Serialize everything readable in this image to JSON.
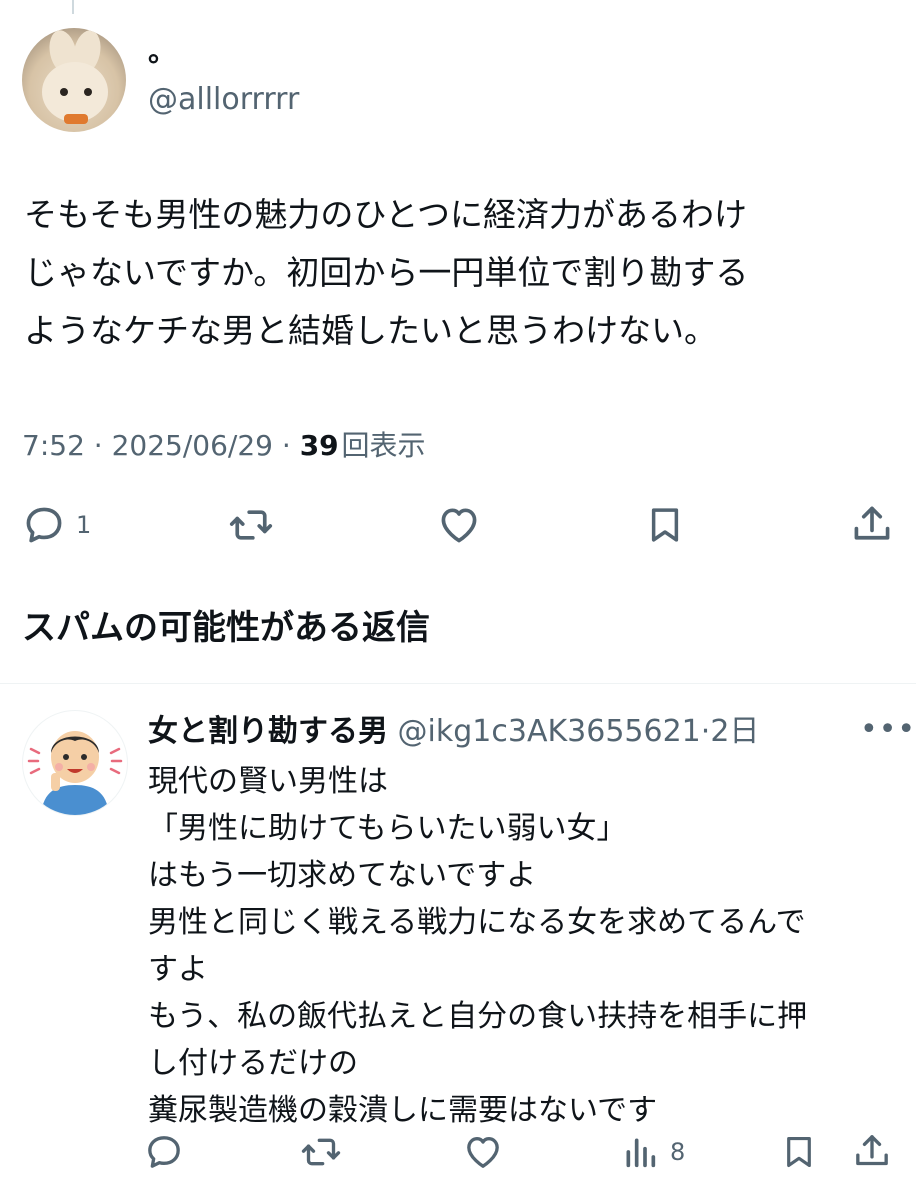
{
  "tweet": {
    "display_name": "。",
    "handle": "@alllorrrrr",
    "text_lines": [
      "そもそも男性の魅力のひとつに経済力があるわけ",
      "じゃないですか。初回から一円単位で割り勘する",
      "ようなケチな男と結婚したいと思うわけない。"
    ],
    "time": "7:52",
    "date": "2025/06/29",
    "separator": " · ",
    "view_count": "39",
    "view_label": "回表示",
    "reply_count": "1"
  },
  "replies_section": {
    "title": "スパムの可能性がある返信"
  },
  "reply": {
    "display_name": "女と割り勘する男",
    "handle": "@ikg1c3AK3655621",
    "time_sep": "·",
    "age": "2日",
    "more_label": "•••",
    "text_lines": [
      "現代の賢い男性は",
      "「男性に助けてもらいたい弱い女」",
      "はもう一切求めてないですよ",
      "男性と同じく戦える戦力になる女を求めてるんで",
      "すよ",
      "もう、私の飯代払えと自分の食い扶持を相手に押",
      "し付けるだけの",
      "糞尿製造機の穀潰しに需要はないです"
    ],
    "view_count": "8"
  },
  "icons": [
    "reply-icon",
    "retweet-icon",
    "like-icon",
    "bookmark-icon",
    "share-icon",
    "views-icon",
    "more-icon"
  ],
  "colors": {
    "text": "#0f1419",
    "secondary": "#536471",
    "divider": "#eff3f4"
  }
}
